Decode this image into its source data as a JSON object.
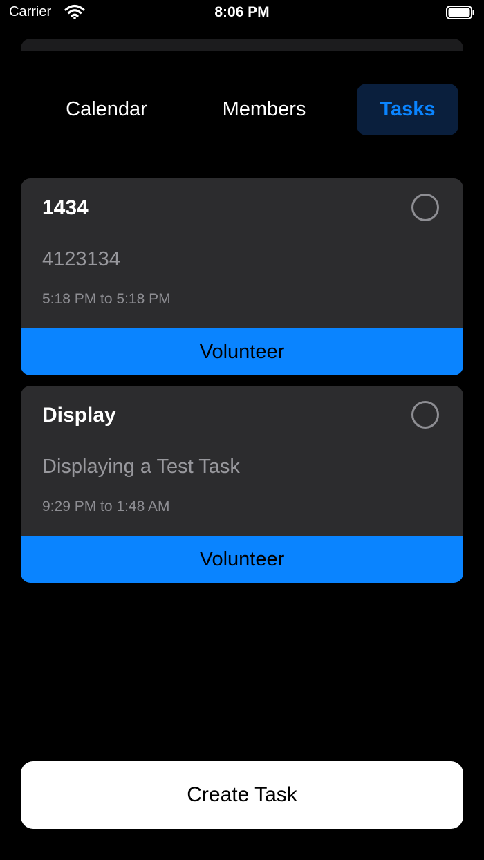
{
  "status_bar": {
    "carrier": "Carrier",
    "time": "8:06 PM",
    "icons": [
      "wifi-icon",
      "battery-icon"
    ]
  },
  "tabs": [
    {
      "label": "Calendar",
      "selected": false
    },
    {
      "label": "Members",
      "selected": false
    },
    {
      "label": "Tasks",
      "selected": true
    }
  ],
  "tasks": [
    {
      "title": "1434",
      "description": "4123134",
      "time_range": "5:18 PM to 5:18 PM",
      "action_label": "Volunteer",
      "completed": false
    },
    {
      "title": "Display",
      "description": "Displaying a Test Task",
      "time_range": "9:29 PM to 1:48 AM",
      "action_label": "Volunteer",
      "completed": false
    }
  ],
  "create_task_label": "Create Task",
  "colors": {
    "background": "#000000",
    "card": "#2c2c2e",
    "accent": "#0a84ff",
    "selected_tab_bg": "#0a1f3d",
    "secondary_text": "#98989d"
  }
}
